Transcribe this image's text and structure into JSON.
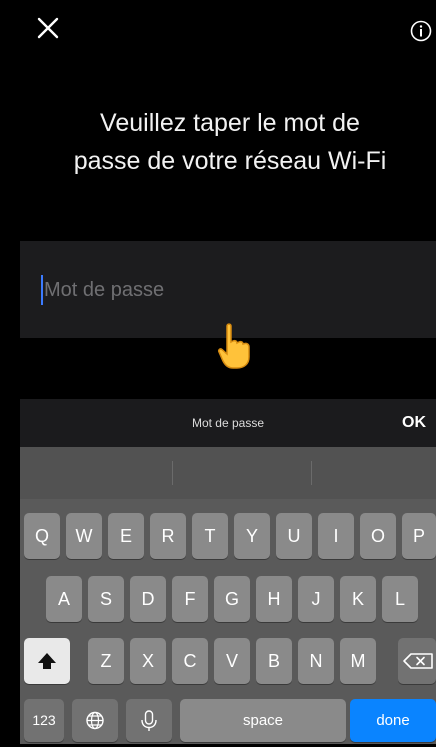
{
  "header": {
    "close_icon": "close-icon",
    "info_icon": "info-icon",
    "title_line1": "Veuillez taper le mot de",
    "title_line2": "passe de votre réseau Wi-Fi"
  },
  "password_field": {
    "placeholder": "Mot de passe",
    "value": ""
  },
  "accessory_bar": {
    "label": "Mot de passe",
    "ok_label": "OK"
  },
  "keyboard": {
    "row1": [
      "Q",
      "W",
      "E",
      "R",
      "T",
      "Y",
      "U",
      "I",
      "O",
      "P"
    ],
    "row2": [
      "A",
      "S",
      "D",
      "F",
      "G",
      "H",
      "J",
      "K",
      "L"
    ],
    "row3": [
      "Z",
      "X",
      "C",
      "V",
      "B",
      "N",
      "M"
    ],
    "numbers_label": "123",
    "space_label": "space",
    "done_label": "done",
    "shift_icon": "shift-icon",
    "delete_icon": "delete-icon",
    "globe_icon": "globe-icon",
    "mic_icon": "microphone-icon"
  },
  "colors": {
    "done_button": "#0a84ff",
    "caret": "#3c7bff"
  }
}
